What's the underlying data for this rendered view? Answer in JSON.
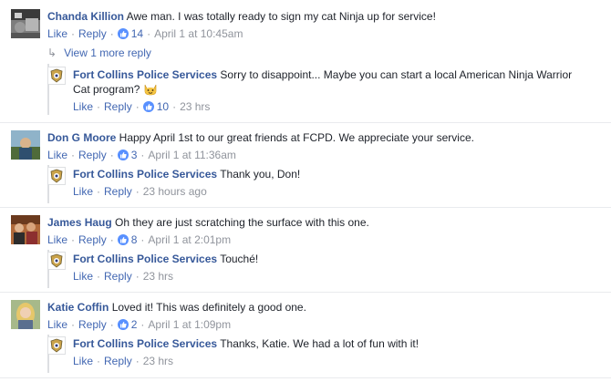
{
  "actions": {
    "like": "Like",
    "reply": "Reply"
  },
  "colors": {
    "author": "#365899",
    "link": "#4267b2",
    "meta": "#90949c",
    "like_badge": "#5890ff"
  },
  "threads": [
    {
      "author": "Chanda Killion",
      "text": "Awe man. I was totally ready to sign my cat Ninja up for service!",
      "likes": "14",
      "time": "April 1 at 10:45am",
      "view_more": "View 1 more reply",
      "reply": {
        "author": "Fort Collins Police Services",
        "text_line1": "Sorry to disappoint... Maybe you can start a local American Ninja Warrior",
        "text_line2": "Cat program?",
        "emoji": "smiling-cat-emoji",
        "likes": "10",
        "time": "23 hrs"
      }
    },
    {
      "author": "Don G Moore",
      "text": "Happy April 1st to our great friends at FCPD. We appreciate your service.",
      "likes": "3",
      "time": "April 1 at 11:36am",
      "reply": {
        "author": "Fort Collins Police Services",
        "text": "Thank you, Don!",
        "time": "23 hours ago"
      }
    },
    {
      "author": "James Haug",
      "text": "Oh they are just scratching the surface with this one.",
      "likes": "8",
      "time": "April 1 at 2:01pm",
      "reply": {
        "author": "Fort Collins Police Services",
        "text": "Touché!",
        "time": "23 hrs"
      }
    },
    {
      "author": "Katie Coffin",
      "text": "Loved it! This was definitely a good one.",
      "likes": "2",
      "time": "April 1 at 1:09pm",
      "reply": {
        "author": "Fort Collins Police Services",
        "text": "Thanks, Katie. We had a lot of fun with it!",
        "time": "23 hrs"
      }
    }
  ]
}
